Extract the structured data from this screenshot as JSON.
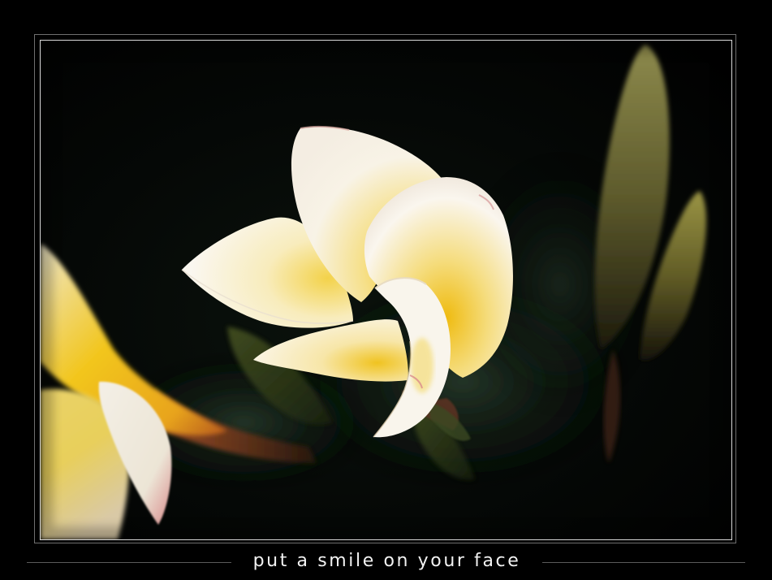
{
  "frame": {
    "caption": "put a smile on your face",
    "colors": {
      "background": "#000000",
      "outer_border": "#6f6f6f",
      "inner_border": "#d9d9d9",
      "caption_text": "#f2f2f2",
      "rule_line": "#5a5a5a"
    }
  },
  "photo": {
    "subject": "flower-photo",
    "colors": {
      "petal_white": "#f7f2e4",
      "petal_yellow": "#f0c51a",
      "petal_pink_edge": "#d78a8c",
      "background_dark": "#040705",
      "foliage_green": "#2a3a1e",
      "bud_green": "#7a7a3a"
    }
  }
}
